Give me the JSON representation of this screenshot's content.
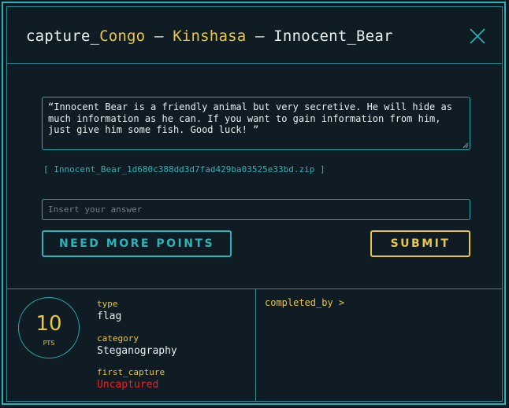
{
  "header": {
    "prefix": "capture_",
    "country": "Congo",
    "sep1": " – ",
    "city": "Kinshasa",
    "sep2": " – ",
    "name": "Innocent_Bear",
    "close_icon": "close-icon"
  },
  "challenge": {
    "description": "“Innocent Bear is a friendly animal but very secretive. He will hide as much information as he can. If you want to gain information from him, just give him some fish. Good luck! ”",
    "file_link": "[ Innocent_Bear_1d680c388dd3d7fad429ba03525e33bd.zip ]"
  },
  "answer": {
    "value": "",
    "placeholder": "Insert your answer"
  },
  "buttons": {
    "more_points": "NEED MORE POINTS",
    "submit": "SUBMIT"
  },
  "info": {
    "points": "10",
    "points_unit": "PTS",
    "type_label": "type",
    "type_value": "flag",
    "category_label": "category",
    "category_value": "Steganography",
    "first_capture_label": "first_capture",
    "first_capture_value": "Uncaptured",
    "completed_by_label": "completed_by >"
  },
  "colors": {
    "background": "#0f1c24",
    "accent": "#2ab3b8",
    "highlight": "#e8c547",
    "danger": "#e02424"
  }
}
